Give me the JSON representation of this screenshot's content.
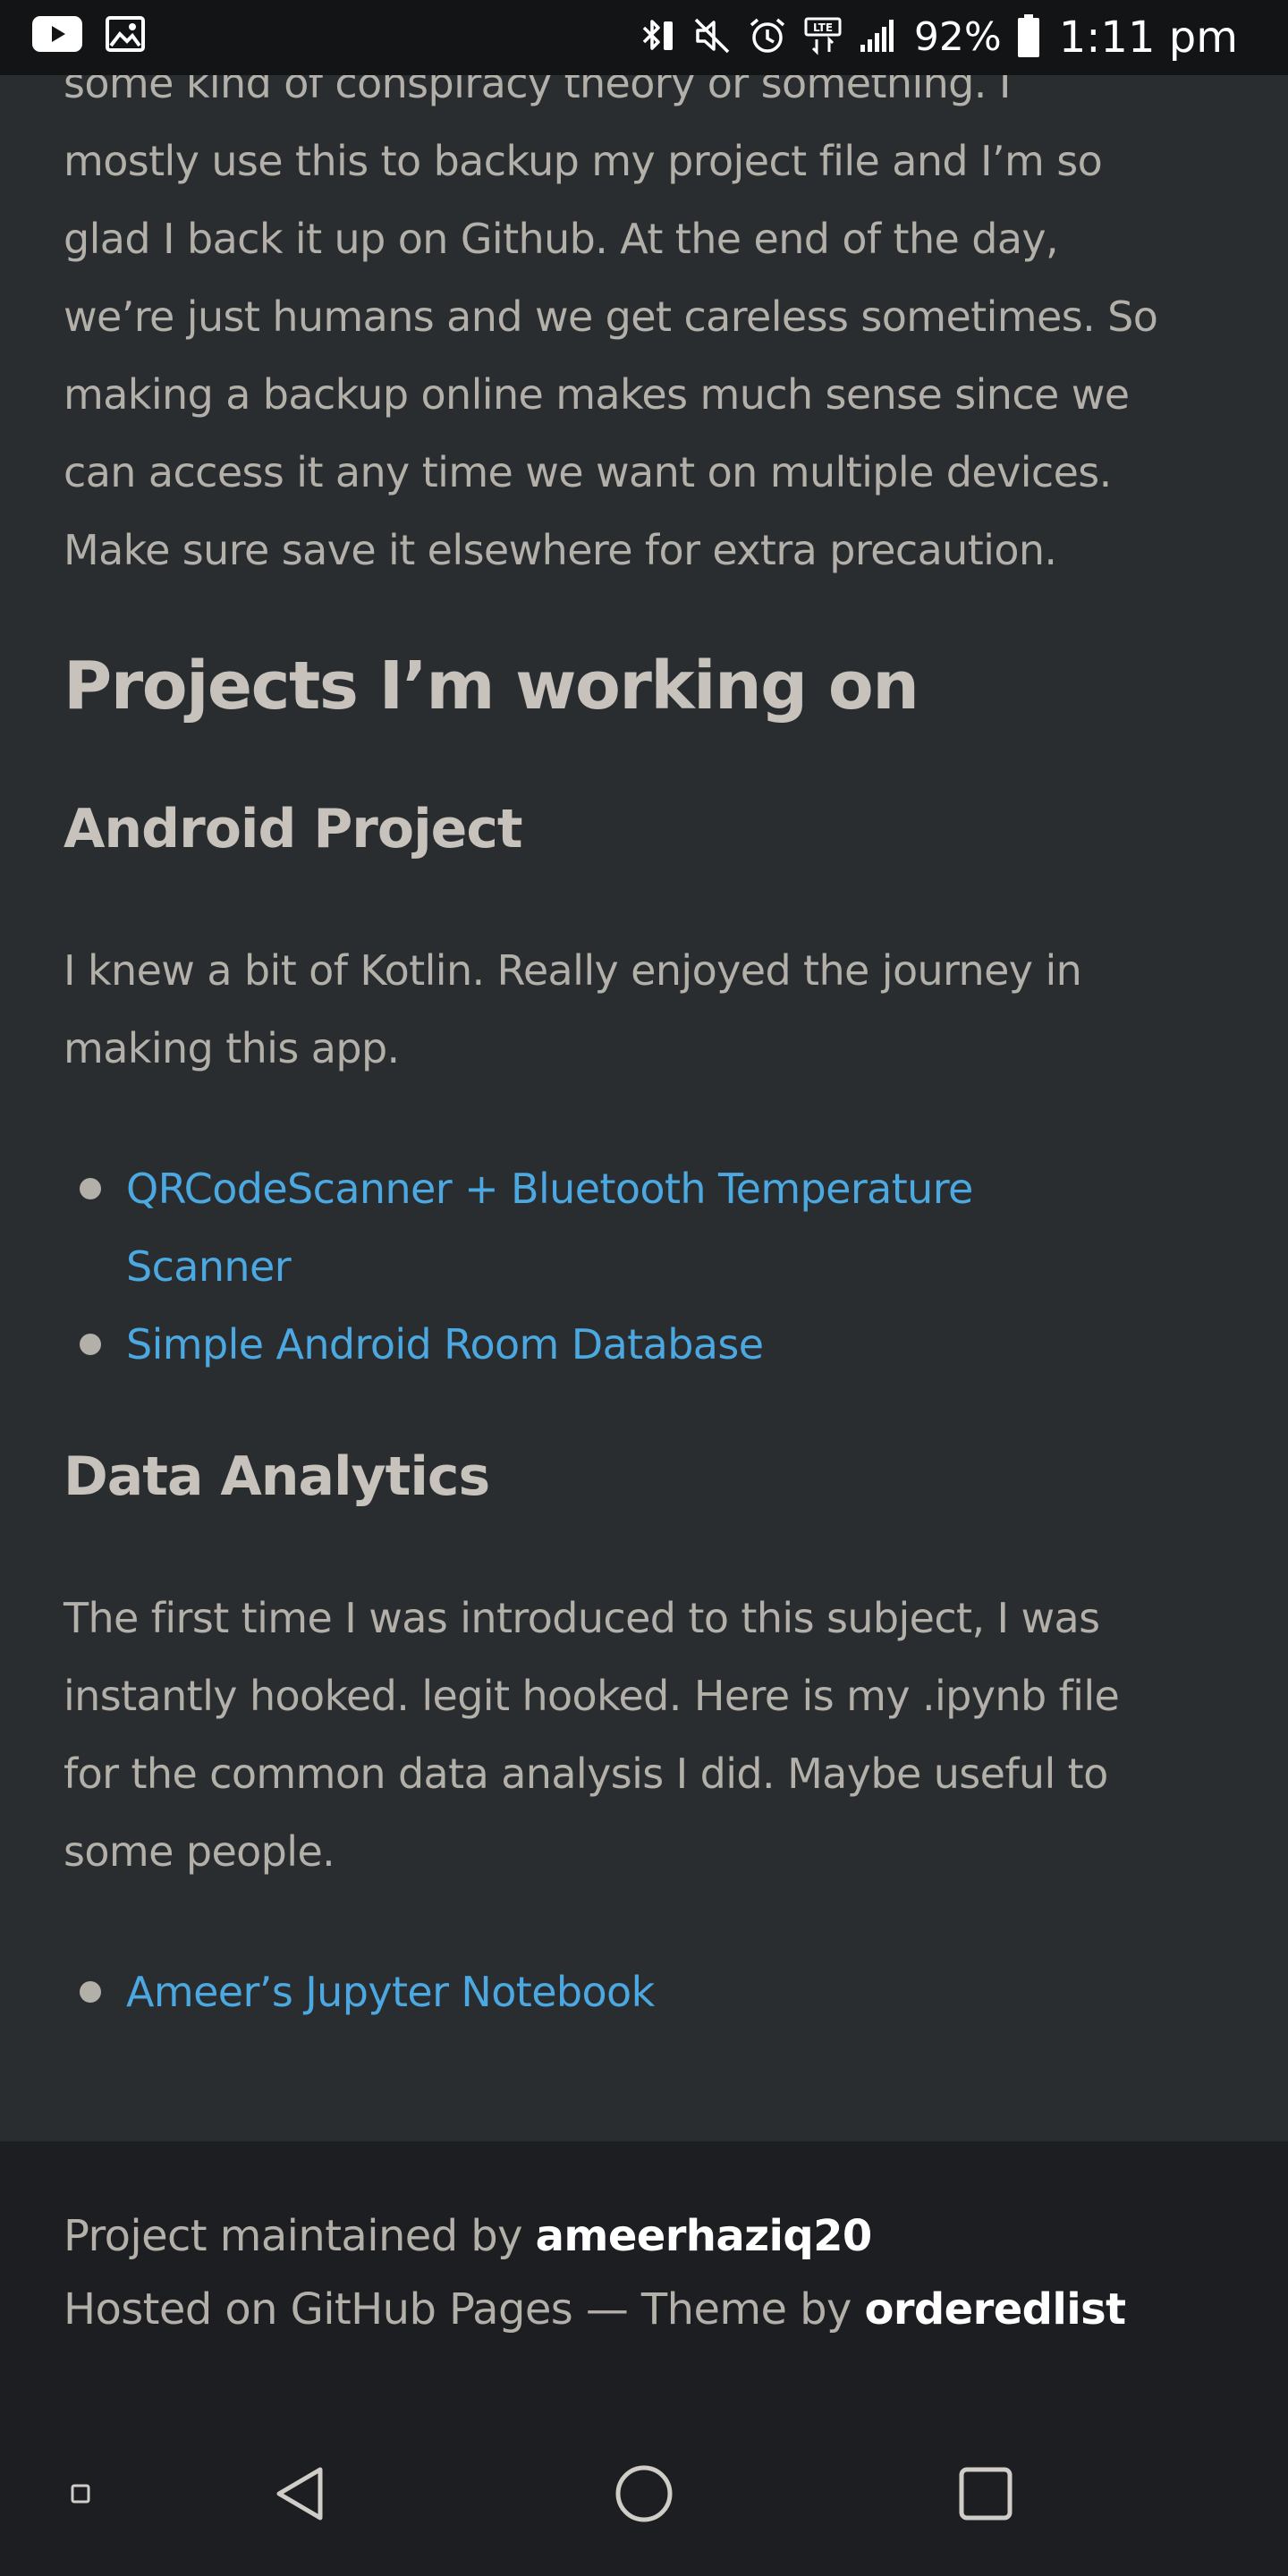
{
  "status_bar": {
    "left_icons": [
      "youtube-icon",
      "image-icon"
    ],
    "right_icons": [
      "bluetooth-icon",
      "mute-icon",
      "alarm-icon",
      "lte-icon",
      "signal-icon",
      "battery-icon"
    ],
    "battery": "92%",
    "time": "1:11 pm"
  },
  "intro": {
    "lines": [
      "some kind of conspiracy theory or something. I",
      "mostly use this to backup my project file and I’m so",
      "glad I back it up on Github. At the end of the day,",
      "we’re just humans and we get careless sometimes. So",
      "making a backup online makes much sense since we",
      "can access it any time we want on multiple devices.",
      "Make sure save it elsewhere for extra precaution."
    ]
  },
  "projects": {
    "heading": "Projects I’m working on",
    "sections": [
      {
        "heading": "Android Project",
        "description_lines": [
          "I knew a bit of Kotlin. Really enjoyed the journey in",
          "making this app."
        ],
        "links": [
          {
            "label_lines": [
              "QRCodeScanner + Bluetooth Temperature",
              "Scanner"
            ]
          },
          {
            "label_lines": [
              "Simple Android Room Database"
            ]
          }
        ]
      },
      {
        "heading": "Data Analytics",
        "description_lines": [
          "The first time I was introduced to this subject, I was",
          "instantly hooked. legit hooked. Here is my .ipynb file",
          "for the common data analysis I did. Maybe useful to",
          "some people."
        ],
        "links": [
          {
            "label_lines": [
              "Ameer’s Jupyter Notebook"
            ]
          }
        ]
      }
    ]
  },
  "footer": {
    "maintained_prefix": "Project maintained by ",
    "maintainer": "ameerhaziq20",
    "hosted_text": "Hosted on GitHub Pages — Theme by ",
    "theme_author": "orderedlist"
  },
  "nav_bar": {
    "buttons": [
      "small-square-icon",
      "back-icon",
      "home-icon",
      "recents-icon"
    ]
  },
  "colors": {
    "background": "#2a2d30",
    "footer_background": "#1d1e21",
    "status_bar": "#131416",
    "body_text": "#b3afa9",
    "heading_text": "#c7c3bc",
    "link": "#4ba8e0",
    "bold_footer": "#ffffff"
  }
}
